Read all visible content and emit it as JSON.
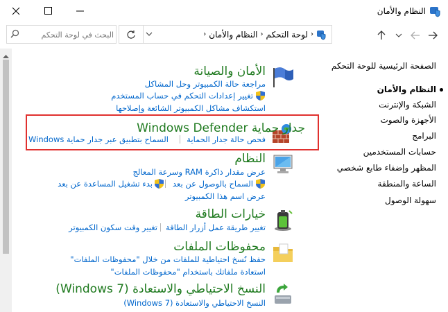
{
  "window": {
    "title": "النظام والأمان"
  },
  "nav": {
    "crumb_root": "لوحة التحكم",
    "crumb_current": "النظام والأمان",
    "search_placeholder": "البحث في لوحة التحكم"
  },
  "sidebar": {
    "home": "الصفحة الرئيسية للوحة التحكم",
    "items": [
      "النظام والأمان",
      "الشبكة والإنترنت",
      "الأجهزة والصوت",
      "البرامج",
      "حسابات المستخدمين",
      "المظهر وإضفاء طابع شخصي",
      "الساعة والمنطقة",
      "سهولة الوصول"
    ]
  },
  "categories": {
    "security": {
      "title": "الأمان والصيانة",
      "l1": "مراجعة حالة الكمبيوتر وحل المشاكل",
      "l2": "تغيير إعدادات التحكم في حساب المستخدم",
      "l3": "استكشاف مشاكل الكمبيوتر الشائعة وإصلاحها"
    },
    "firewall": {
      "title": "جدار حماية Windows Defender",
      "l1": "فحص حالة جدار الحماية",
      "l2": "السماح بتطبيق عبر جدار حماية Windows"
    },
    "system": {
      "title": "النظام",
      "l1": "عرض مقدار ذاكرة RAM وسرعة المعالج",
      "l2": "السماح بالوصول عن بعد",
      "l3": "بدء تشغيل المساعدة عن بعد",
      "l4": "عرض اسم هذا الكمبيوتر"
    },
    "power": {
      "title": "خيارات الطاقة",
      "l1": "تغيير طريقة عمل أزرار الطاقة",
      "l2": "تغيير وقت سكون الكمبيوتر"
    },
    "filehistory": {
      "title": "محفوظات الملفات",
      "l1": "حفظ نُسخ احتياطية للملفات من خلال \"محفوظات الملفات\"",
      "l2": "استعادة ملفاتك باستخدام \"محفوظات الملفات\""
    },
    "backup": {
      "title": "النسخ الاحتياطي والاستعادة (Windows 7)",
      "l1": "النسخ الاحتياطي والاستعادة (Windows 7)"
    }
  }
}
